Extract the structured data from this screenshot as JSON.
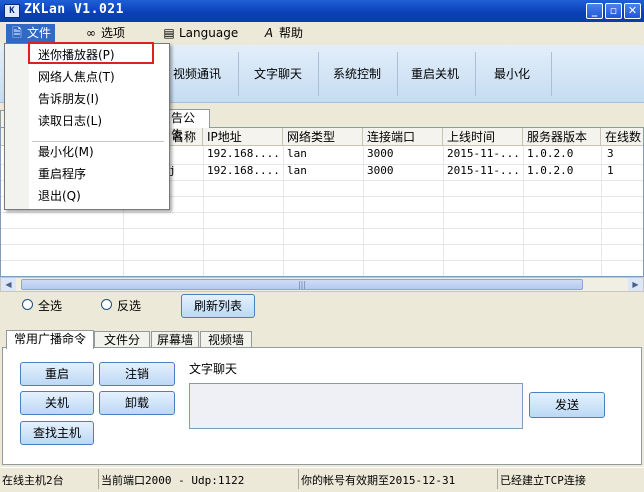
{
  "window": {
    "title": "ZKLan V1.021",
    "icon_label": "K",
    "min_symbol": "_",
    "max_symbol": "▫",
    "close_symbol": "✕"
  },
  "menubar": {
    "items": [
      {
        "label": "文件",
        "icon": "file-icon"
      },
      {
        "label": "选项",
        "icon": "glasses-icon"
      },
      {
        "label": "Language",
        "icon": "language-icon"
      },
      {
        "label": "帮助",
        "icon": "help-icon"
      }
    ]
  },
  "file_menu": {
    "items": [
      "迷你播放器(P)",
      "网络人焦点(T)",
      "告诉朋友(I)",
      "读取日志(L)",
      "最小化(M)",
      "重启程序",
      "退出(Q)"
    ]
  },
  "toolbar": {
    "buttons": [
      "视频通讯",
      "文字聊天",
      "系统控制",
      "重启关机",
      "最小化"
    ]
  },
  "top_tabs": [
    "告公告"
  ],
  "grid": {
    "columns": [
      "名称",
      "IP地址",
      "网络类型",
      "连接端口",
      "上线时间",
      "服务器版本",
      "在线数"
    ],
    "rows": [
      {
        "name": "",
        "ip": "192.168....",
        "net": "lan",
        "port": "3000",
        "time": "2015-11-...",
        "ver": "1.0.2.0",
        "online": "3"
      },
      {
        "name": "j",
        "ip": "192.168....",
        "net": "lan",
        "port": "3000",
        "time": "2015-11-...",
        "ver": "1.0.2.0",
        "online": "1"
      }
    ],
    "scroll_grip": "|||"
  },
  "selection": {
    "select_all": "全选",
    "invert": "反选",
    "refresh": "刷新列表"
  },
  "bottom_tabs": [
    "常用广播命令",
    "文件分发",
    "屏幕墙",
    "视频墙"
  ],
  "commands": {
    "restart": "重启",
    "logout": "注销",
    "shutdown": "关机",
    "uninstall": "卸载",
    "find_host": "查找主机"
  },
  "chat": {
    "label": "文字聊天",
    "input_value": "",
    "send": "发送"
  },
  "status": {
    "online_hosts": "在线主机2台",
    "ports": "当前端口2000 - Udp:1122",
    "expiry": "你的帐号有效期至2015-12-31",
    "tcp": "已经建立TCP连接"
  }
}
